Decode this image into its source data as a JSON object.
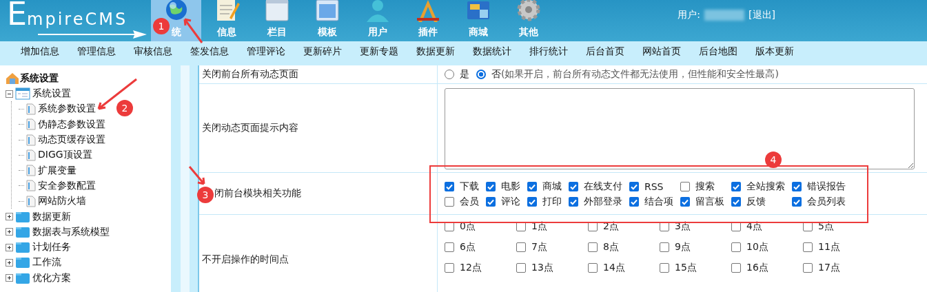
{
  "logo": {
    "text": "EmpireCMS"
  },
  "top_nav": [
    {
      "label": "统",
      "selected": true
    },
    {
      "label": "信息",
      "selected": false
    },
    {
      "label": "栏目",
      "selected": false
    },
    {
      "label": "模板",
      "selected": false
    },
    {
      "label": "用户",
      "selected": false
    },
    {
      "label": "插件",
      "selected": false
    },
    {
      "label": "商城",
      "selected": false
    },
    {
      "label": "其他",
      "selected": false
    }
  ],
  "user": {
    "label": "用户:",
    "logout": "[退出]"
  },
  "sub_nav": [
    "增加信息",
    "管理信息",
    "审核信息",
    "签发信息",
    "管理评论",
    "更新碎片",
    "更新专题",
    "数据更新",
    "数据统计",
    "排行统计",
    "后台首页",
    "网站首页",
    "后台地图",
    "版本更新"
  ],
  "sidebar": {
    "title": "系统设置",
    "items": [
      {
        "label": "系统设置",
        "expanded": true,
        "children": [
          {
            "label": "系统参数设置"
          },
          {
            "label": "伪静态参数设置"
          },
          {
            "label": "动态页缓存设置"
          },
          {
            "label": "DIGG顶设置"
          },
          {
            "label": "扩展变量"
          },
          {
            "label": "安全参数配置"
          },
          {
            "label": "网站防火墙"
          }
        ]
      },
      {
        "label": "数据更新",
        "expanded": false
      },
      {
        "label": "数据表与系统模型",
        "expanded": false
      },
      {
        "label": "计划任务",
        "expanded": false
      },
      {
        "label": "工作流",
        "expanded": false
      },
      {
        "label": "优化方案",
        "expanded": false
      }
    ]
  },
  "settings": [
    {
      "kind": "radio",
      "label": "关闭前台所有动态页面",
      "options": [
        {
          "label": "是",
          "selected": false
        },
        {
          "label": "否",
          "selected": true
        }
      ],
      "note": "(如果开启，前台所有动态文件都无法使用，但性能和安全性最高)"
    },
    {
      "kind": "textarea",
      "label": "关闭动态页面提示内容"
    },
    {
      "kind": "checkboxes",
      "label": "闭前台模块相关功能",
      "options": [
        {
          "label": "下载",
          "checked": true
        },
        {
          "label": "电影",
          "checked": true
        },
        {
          "label": "商城",
          "checked": true
        },
        {
          "label": "在线支付",
          "checked": true
        },
        {
          "label": "RSS",
          "checked": true
        },
        {
          "label": "搜索",
          "checked": false
        },
        {
          "label": "全站搜索",
          "checked": true
        },
        {
          "label": "错误报告",
          "checked": true
        },
        {
          "label": "会员",
          "checked": false
        },
        {
          "label": "评论",
          "checked": true
        },
        {
          "label": "打印",
          "checked": true
        },
        {
          "label": "外部登录",
          "checked": true
        },
        {
          "label": "结合项",
          "checked": true
        },
        {
          "label": "留言板",
          "checked": true
        },
        {
          "label": "反馈",
          "checked": true
        },
        {
          "label": "会员列表",
          "checked": true
        }
      ]
    },
    {
      "kind": "hours",
      "label": "不开启操作的时间点",
      "options": [
        {
          "label": "0点",
          "checked": false
        },
        {
          "label": "1点",
          "checked": false
        },
        {
          "label": "2点",
          "checked": false
        },
        {
          "label": "3点",
          "checked": false
        },
        {
          "label": "4点",
          "checked": false
        },
        {
          "label": "5点",
          "checked": false
        },
        {
          "label": "6点",
          "checked": false
        },
        {
          "label": "7点",
          "checked": false
        },
        {
          "label": "8点",
          "checked": false
        },
        {
          "label": "9点",
          "checked": false
        },
        {
          "label": "10点",
          "checked": false
        },
        {
          "label": "11点",
          "checked": false
        },
        {
          "label": "12点",
          "checked": false
        },
        {
          "label": "13点",
          "checked": false
        },
        {
          "label": "14点",
          "checked": false
        },
        {
          "label": "15点",
          "checked": false
        },
        {
          "label": "16点",
          "checked": false
        },
        {
          "label": "17点",
          "checked": false
        }
      ]
    }
  ],
  "annotations": [
    "1",
    "2",
    "3",
    "4"
  ]
}
